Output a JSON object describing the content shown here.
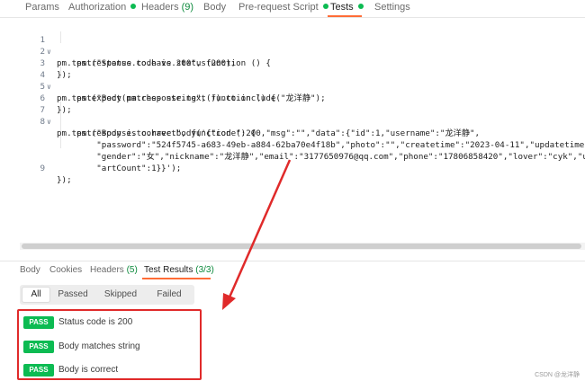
{
  "request_tabs": [
    {
      "label": "Params",
      "count": "",
      "dot": false,
      "active": false
    },
    {
      "label": "Authorization",
      "count": "",
      "dot": true,
      "active": false
    },
    {
      "label": "Headers",
      "count": "(9)",
      "dot": false,
      "active": false
    },
    {
      "label": "Body",
      "count": "",
      "dot": false,
      "active": false
    },
    {
      "label": "Pre-request Script",
      "count": "",
      "dot": true,
      "active": false
    },
    {
      "label": "Tests",
      "count": "",
      "dot": true,
      "active": true
    },
    {
      "label": "Settings",
      "count": "",
      "dot": false,
      "active": false
    }
  ],
  "editor": {
    "lines": [
      {
        "num": "1",
        "fold": true,
        "text": "pm.test(\"Status code is 200\", function () {"
      },
      {
        "num": "2",
        "fold": false,
        "text": "    pm.response.to.have.status(200);"
      },
      {
        "num": "3",
        "fold": false,
        "text": "});"
      },
      {
        "num": "4",
        "fold": true,
        "text": "pm.test(\"Body matches string\", function () {"
      },
      {
        "num": "5",
        "fold": false,
        "text": "    pm.expect(pm.response.text()).to.include(\"龙洋静\");"
      },
      {
        "num": "6",
        "fold": false,
        "text": "});"
      },
      {
        "num": "7",
        "fold": true,
        "text": "pm.test(\"Body is correct\", function () {"
      },
      {
        "num": "8",
        "fold": false,
        "text": "    pm.response.to.have.body('{\"code\":200,\"msg\":\"\",\"data\":{\"id\":1,\"username\":\"龙洋静\","
      },
      {
        "num": "",
        "fold": false,
        "text": "        \"password\":\"524f5745-a683-49eb-a884-62ba70e4f18b\",\"photo\":\"\",\"createtime\":\"2023-04-11\",\"updatetime\":\"2023"
      },
      {
        "num": "",
        "fold": false,
        "text": "        \"gender\":\"女\",\"nickname\":\"龙洋静\",\"email\":\"3177650976@qq.com\",\"phone\":\"17806858420\",\"lover\":\"cyk\",\"unfreez"
      },
      {
        "num": "",
        "fold": false,
        "text": "        \"artCount\":1}}');"
      },
      {
        "num": "9",
        "fold": false,
        "text": "});"
      }
    ]
  },
  "response_tabs": [
    {
      "label": "Body",
      "count": "",
      "active": false
    },
    {
      "label": "Cookies",
      "count": "",
      "active": false
    },
    {
      "label": "Headers",
      "count": "(5)",
      "active": false
    },
    {
      "label": "Test Results",
      "count": "(3/3)",
      "active": true
    }
  ],
  "filters": [
    {
      "label": "All",
      "active": true
    },
    {
      "label": "Passed",
      "active": false
    },
    {
      "label": "Skipped",
      "active": false
    },
    {
      "label": "Failed",
      "active": false
    }
  ],
  "results": [
    {
      "status": "PASS",
      "name": "Status code is 200"
    },
    {
      "status": "PASS",
      "name": "Body matches string"
    },
    {
      "status": "PASS",
      "name": "Body is correct"
    }
  ],
  "colors": {
    "accent": "#ff6c37",
    "pass": "#0cbb52",
    "annotation": "#e02a2a"
  },
  "watermark": "CSDN @龙洋静"
}
